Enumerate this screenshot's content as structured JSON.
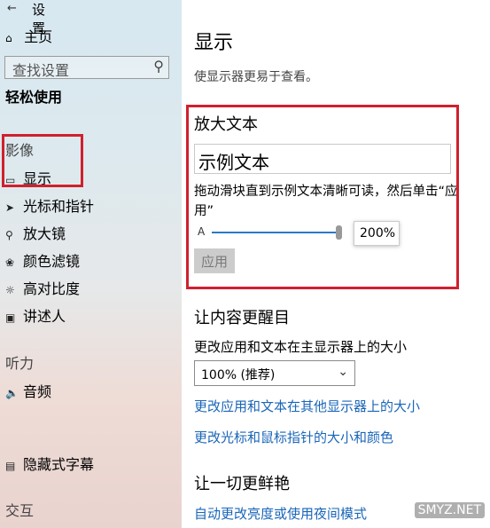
{
  "sidebar": {
    "window_title": "设置",
    "back_icon": "back-arrow-icon",
    "home_label": "主页",
    "search_placeholder": "查找设置",
    "category": "轻松使用",
    "sections": [
      {
        "label": "影像",
        "items": [
          {
            "label": "显示",
            "icon": "monitor-icon",
            "selected": true
          },
          {
            "label": "光标和指针",
            "icon": "cursor-icon"
          },
          {
            "label": "放大镜",
            "icon": "magnifier-icon"
          },
          {
            "label": "颜色滤镜",
            "icon": "color-filter-icon"
          },
          {
            "label": "高对比度",
            "icon": "contrast-icon"
          },
          {
            "label": "讲述人",
            "icon": "narrator-icon"
          }
        ]
      },
      {
        "label": "听力",
        "items": [
          {
            "label": "音频",
            "icon": "speaker-icon"
          },
          {
            "label": "隐藏式字幕",
            "icon": "captions-icon"
          }
        ]
      },
      {
        "label": "交互",
        "items": []
      }
    ]
  },
  "main": {
    "title": "显示",
    "description": "使显示器更易于查看。",
    "enlarge_text": {
      "heading": "放大文本",
      "sample_text": "示例文本",
      "instruction": "拖动滑块直到示例文本清晰可读，然后单击“应用”",
      "slider_min_label": "A",
      "slider_value": "200%",
      "slider_fraction": 0.97,
      "apply_label": "应用"
    },
    "make_bigger": {
      "heading": "让内容更醒目",
      "scale_label": "更改应用和文本在主显示器上的大小",
      "scale_value": "100% (推荐)",
      "link_other_displays": "更改应用和文本在其他显示器上的大小",
      "link_cursor": "更改光标和鼠标指针的大小和颜色"
    },
    "brighter": {
      "heading": "让一切更鲜艳",
      "link_brightness": "自动更改亮度或使用夜间模式"
    }
  },
  "watermark": "SMYZ.NET",
  "colors": {
    "link": "#1a66b8",
    "slider_accent": "#2a78c6",
    "highlight_box": "#d0202e"
  }
}
